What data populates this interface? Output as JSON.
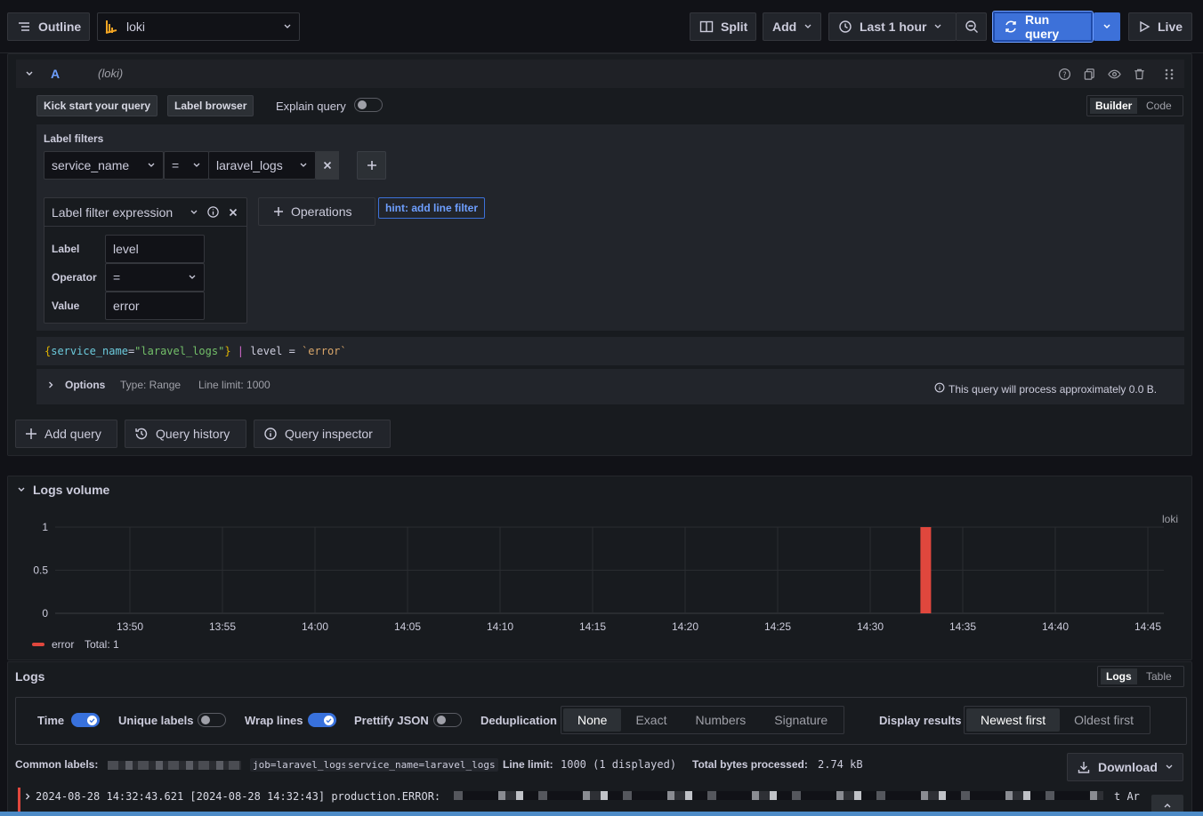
{
  "toolbar": {
    "outline": "Outline",
    "datasource": "loki",
    "split": "Split",
    "add": "Add",
    "time_range": "Last 1 hour",
    "run_query": "Run query",
    "live": "Live"
  },
  "query": {
    "ref_id": "A",
    "datasource_label": "(loki)",
    "kick_start": "Kick start your query",
    "label_browser": "Label browser",
    "explain": "Explain query",
    "mode_builder": "Builder",
    "mode_code": "Code",
    "label_filters_title": "Label filters",
    "filter_label": "service_name",
    "filter_op": "=",
    "filter_value": "laravel_logs",
    "expr_title": "Label filter expression",
    "expr_label_caption": "Label",
    "expr_label_value": "level",
    "expr_operator_caption": "Operator",
    "expr_operator_value": "=",
    "expr_value_caption": "Value",
    "expr_value_value": "error",
    "operations": "Operations",
    "hint": "hint: add line filter",
    "preview_open": "{",
    "preview_key": "service_name",
    "preview_eq": "=",
    "preview_val": "\"laravel_logs\"",
    "preview_close": "}",
    "preview_pipe": "|",
    "preview_rest": "level = ",
    "preview_rest_val": "`error`",
    "options": "Options",
    "options_type": "Type: Range",
    "options_limit": "Line limit: 1000",
    "process_note": "This query will process approximately 0.0 B."
  },
  "actions": {
    "add_query": "Add query",
    "query_history": "Query history",
    "query_inspector": "Query inspector"
  },
  "volume": {
    "title": "Logs volume",
    "series_label": "loki",
    "legend_name": "error",
    "legend_total": "Total: 1"
  },
  "chart_data": {
    "type": "bar",
    "title": "Logs volume",
    "x": [
      "14:33"
    ],
    "series": [
      {
        "name": "error",
        "values": [
          1
        ],
        "color": "#e0473d"
      }
    ],
    "ylim": [
      0,
      1
    ],
    "yticks": [
      "1",
      "0.5",
      "0"
    ],
    "xticks": [
      "13:50",
      "13:55",
      "14:00",
      "14:05",
      "14:10",
      "14:15",
      "14:20",
      "14:25",
      "14:30",
      "14:35",
      "14:40",
      "14:45"
    ],
    "grid": true
  },
  "logs": {
    "title": "Logs",
    "view_logs": "Logs",
    "view_table": "Table",
    "time": "Time",
    "unique_labels": "Unique labels",
    "wrap_lines": "Wrap lines",
    "prettify_json": "Prettify JSON",
    "dedup": "Deduplication",
    "dedup_options": [
      "None",
      "Exact",
      "Numbers",
      "Signature"
    ],
    "display_results": "Display results",
    "order_options": [
      "Newest first",
      "Oldest first"
    ],
    "common_labels": "Common labels:",
    "label_job": "job=laravel_logs",
    "label_service": "service_name=laravel_logs",
    "line_limit_caption": "Line limit:",
    "line_limit_value": "1000 (1 displayed)",
    "bytes_caption": "Total bytes processed:",
    "bytes_value": "2.74 kB",
    "download": "Download",
    "row_text": "2024-08-28 14:32:43.621 [2024-08-28 14:32:43] production.ERROR:",
    "row_tail": "t Ar"
  },
  "colors": {
    "accent": "#3d71d9",
    "error": "#e0473d"
  }
}
